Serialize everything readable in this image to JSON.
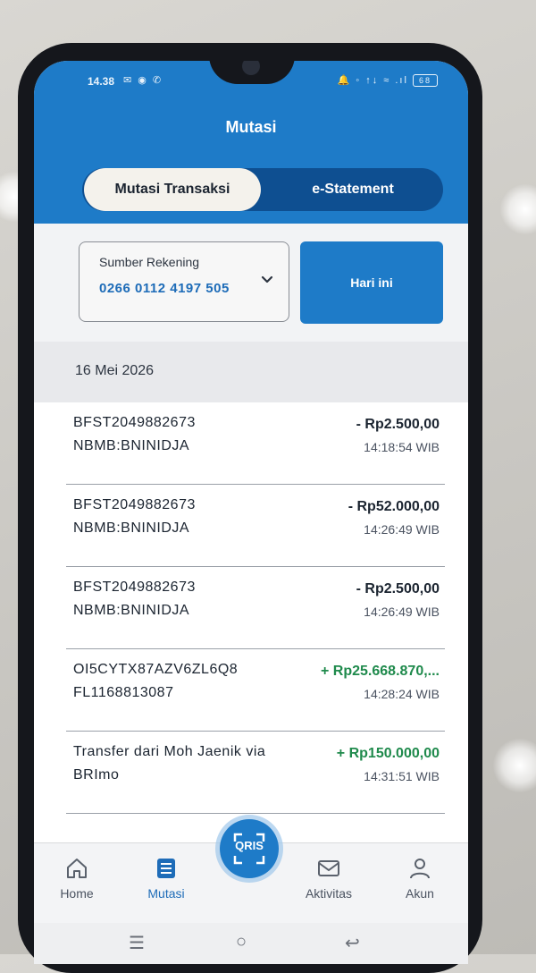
{
  "status_bar": {
    "time": "14.38",
    "left_icons": "✉ ◉ ✆",
    "right_icons": "🔔 ◦ ↑↓ ≈ .ıl",
    "battery": "68"
  },
  "header": {
    "title": "Mutasi"
  },
  "tabs": [
    {
      "label": "Mutasi Transaksi",
      "active": true
    },
    {
      "label": "e-Statement",
      "active": false
    }
  ],
  "source_account": {
    "label": "Sumber Rekening",
    "value": "0266 0112 4197 505"
  },
  "period_button": {
    "label": "Hari ini"
  },
  "date_header": "16 Mei 2026",
  "transactions": [
    {
      "line1": "BFST2049882673",
      "line2": "NBMB:BNINIDJA",
      "amount": "- Rp2.500,00",
      "time": "14:18:54 WIB",
      "type": "debit"
    },
    {
      "line1": "BFST2049882673",
      "line2": "NBMB:BNINIDJA",
      "amount": "- Rp52.000,00",
      "time": "14:26:49 WIB",
      "type": "debit"
    },
    {
      "line1": "BFST2049882673",
      "line2": "NBMB:BNINIDJA",
      "amount": "- Rp2.500,00",
      "time": "14:26:49 WIB",
      "type": "debit"
    },
    {
      "line1": "OI5CYTX87AZV6ZL6Q8",
      "line2": "FL1168813087",
      "amount": "+ Rp25.668.870,...",
      "time": "14:28:24 WIB",
      "type": "credit"
    },
    {
      "line1": "Transfer dari Moh Jaenik via",
      "line2": "BRImo",
      "amount": "+ Rp150.000,00",
      "time": "14:31:51 WIB",
      "type": "credit"
    }
  ],
  "bottom_nav": [
    {
      "label": "Home",
      "icon": "home-icon",
      "active": false
    },
    {
      "label": "Mutasi",
      "icon": "list-icon",
      "active": true
    },
    {
      "label": "Aktivitas",
      "icon": "envelope-icon",
      "active": false
    },
    {
      "label": "Akun",
      "icon": "person-icon",
      "active": false
    }
  ],
  "qris": {
    "label": "QRIS",
    "icon": "qr-scan-icon"
  },
  "system_nav": {
    "recents": "☰",
    "home": "○",
    "back": "↩"
  },
  "colors": {
    "brand_blue": "#1e7bc8",
    "dark_blue": "#0e4f91",
    "credit_green": "#1f8a4c",
    "link_blue": "#1e6cb8"
  }
}
